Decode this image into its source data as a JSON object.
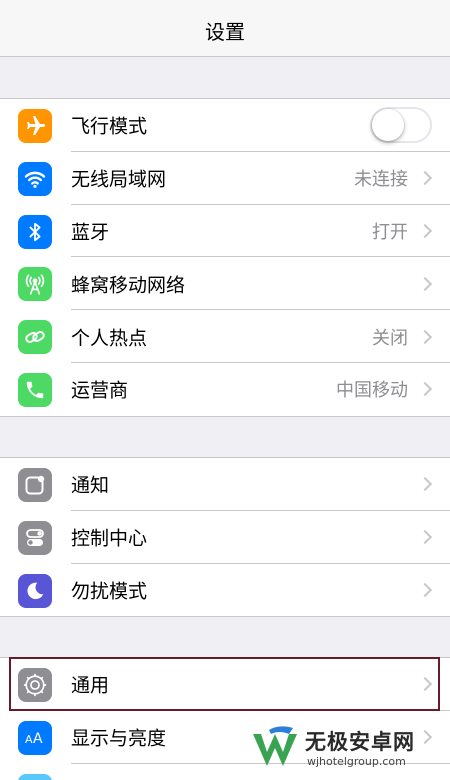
{
  "header": {
    "title": "设置"
  },
  "group1": [
    {
      "label": "飞行模式",
      "icon": "airplane-icon",
      "color": "#ff9500",
      "toggle": false
    },
    {
      "label": "无线局域网",
      "icon": "wifi-icon",
      "color": "#007aff",
      "value": "未连接"
    },
    {
      "label": "蓝牙",
      "icon": "bluetooth-icon",
      "color": "#007aff",
      "value": "打开"
    },
    {
      "label": "蜂窝移动网络",
      "icon": "cellular-icon",
      "color": "#4cd964",
      "value": ""
    },
    {
      "label": "个人热点",
      "icon": "hotspot-icon",
      "color": "#4cd964",
      "value": "关闭"
    },
    {
      "label": "运营商",
      "icon": "phone-icon",
      "color": "#4cd964",
      "value": "中国移动"
    }
  ],
  "group2": [
    {
      "label": "通知",
      "icon": "notification-icon",
      "color": "#8e8e93"
    },
    {
      "label": "控制中心",
      "icon": "control-center-icon",
      "color": "#8e8e93"
    },
    {
      "label": "勿扰模式",
      "icon": "moon-icon",
      "color": "#5856d6"
    }
  ],
  "group3": [
    {
      "label": "通用",
      "icon": "gear-icon",
      "color": "#8e8e93"
    },
    {
      "label": "显示与亮度",
      "icon": "display-icon",
      "color": "#007aff"
    }
  ],
  "watermark": {
    "name": "无极安卓网",
    "url": "wjhotelgroup.com"
  }
}
